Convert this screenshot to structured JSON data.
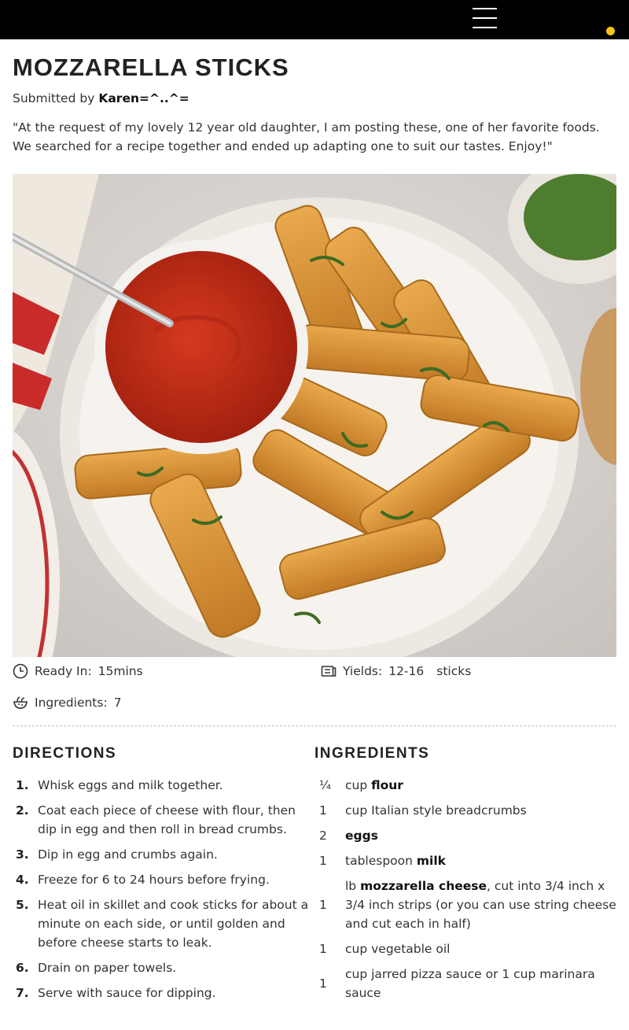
{
  "colors": {
    "topbar": "#000000",
    "accent_dot": "#f5c518"
  },
  "header": {
    "menu_icon": "hamburger-menu-icon"
  },
  "recipe": {
    "title": "MOZZARELLA STICKS",
    "submitted_prefix": "Submitted by",
    "author": "Karen=^..^=",
    "description": "\"At the request of my lovely 12 year old daughter, I am posting these, one of her favorite foods. We searched for a recipe together and ended up adapting one to suit our tastes. Enjoy!\""
  },
  "meta": {
    "ready_label": "Ready In:",
    "ready_value": "15mins",
    "yields_label": "Yields:",
    "yields_value": "12-16",
    "yields_unit": "sticks",
    "ingredients_label": "Ingredients:",
    "ingredients_value": "7"
  },
  "directions": {
    "heading": "DIRECTIONS",
    "steps": [
      {
        "num": "1.",
        "text": "Whisk eggs and milk together."
      },
      {
        "num": "2.",
        "text": "Coat each piece of cheese with flour, then dip in egg and then roll in bread crumbs."
      },
      {
        "num": "3.",
        "text": "Dip in egg and crumbs again."
      },
      {
        "num": "4.",
        "text": "Freeze for 6 to 24 hours before frying."
      },
      {
        "num": "5.",
        "text": "Heat oil in skillet and cook sticks for about a minute on each side, or until golden and before cheese starts to leak."
      },
      {
        "num": "6.",
        "text": "Drain on paper towels."
      },
      {
        "num": "7.",
        "text": "Serve with sauce for dipping."
      }
    ]
  },
  "ingredients": {
    "heading": "INGREDIENTS",
    "items": [
      {
        "qty": "¼",
        "unit": "cup",
        "name": "flour",
        "rest": ""
      },
      {
        "qty": "1",
        "unit": "cup",
        "name": "",
        "rest": "Italian style breadcrumbs"
      },
      {
        "qty": "2",
        "unit": "",
        "name": "eggs",
        "rest": ""
      },
      {
        "qty": "1",
        "unit": "tablespoon",
        "name": "milk",
        "rest": ""
      },
      {
        "qty": "1",
        "unit": "lb",
        "name": "mozzarella cheese",
        "rest": ", cut into 3/4 inch x 3/4 inch strips (or you can use string cheese and cut each in half)"
      },
      {
        "qty": "1",
        "unit": "cup",
        "name": "",
        "rest": "vegetable oil"
      },
      {
        "qty": "1",
        "unit": "cup",
        "name": "",
        "rest": "jarred pizza sauce or 1 cup marinara sauce"
      }
    ]
  }
}
